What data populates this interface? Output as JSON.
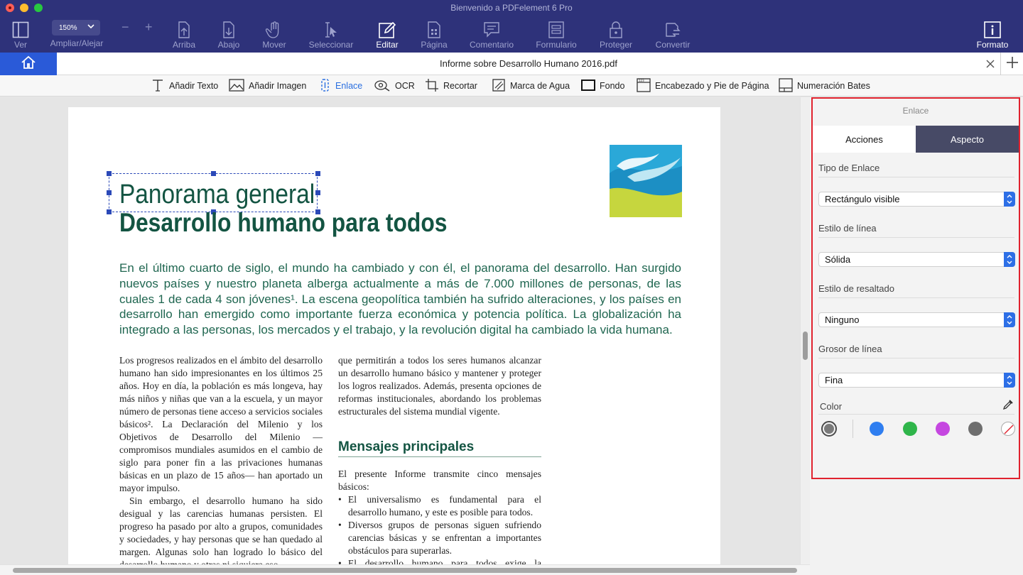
{
  "window": {
    "title": "Bienvenido a PDFelement 6 Pro"
  },
  "toolbar": {
    "ver": "Ver",
    "zoom_value": "150%",
    "zoom_label": "Ampliar/Alejar",
    "zoom_out": "−",
    "zoom_in": "+",
    "arriba": "Arriba",
    "abajo": "Abajo",
    "mover": "Mover",
    "seleccionar": "Seleccionar",
    "editar": "Editar",
    "pagina": "Página",
    "comentario": "Comentario",
    "formulario": "Formulario",
    "proteger": "Proteger",
    "convertir": "Convertir",
    "formato": "Formato"
  },
  "tab": {
    "title": "Informe sobre Desarrollo Humano 2016.pdf"
  },
  "edit_tools": {
    "add_text": "Añadir Texto",
    "add_image": "Añadir Imagen",
    "link": "Enlace",
    "ocr": "OCR",
    "crop": "Recortar",
    "watermark": "Marca de Agua",
    "background": "Fondo",
    "header_footer": "Encabezado y Pie de Página",
    "bates": "Numeración Bates"
  },
  "document": {
    "title": "Panorama general",
    "heading": "Desarrollo humano para todos",
    "intro": "En el último cuarto de siglo, el mundo ha cambiado y con él, el panorama del desarrollo. Han surgido nuevos países y nuestro planeta alberga actualmente a más de 7.000 millones de personas, de las cuales 1 de cada 4 son jóvenes¹. La escena geopolítica también ha sufrido alteraciones, y los países en desarrollo han emergido como importante fuerza económica y potencia política. La globalización ha integrado a las personas, los mercados y el trabajo, y la revolución digital ha cambiado la vida humana.",
    "col1_p1": "Los progresos realizados en el ámbito del desarrollo humano han sido impresionantes en los últimos 25 años. Hoy en día, la población es más longeva, hay más niños y niñas que van a la escuela, y un mayor número de personas tiene acceso a servicios sociales básicos². La Declaración del Milenio y los Objetivos de Desarrollo del Milenio —compromisos mundiales asumidos en el cambio de siglo para poner fin a las privaciones humanas básicas en un plazo de 15 años— han aportado un mayor impulso.",
    "col1_p2": "Sin embargo, el desarrollo humano ha sido desigual y las carencias humanas persisten. El progreso ha pasado por alto a grupos, comunidades y sociedades, y hay personas que se han quedado al margen. Algunas solo han logrado lo básico del desarrollo humano y otras ni siquiera eso.",
    "col2_p1": "que permitirán a todos los seres humanos alcanzar un desarrollo humano básico y mantener y proteger los logros realizados. Además, presenta opciones de reformas institucionales, abordando los problemas estructurales del sistema mundial vigente.",
    "messages_heading": "Mensajes principales",
    "messages_intro": "El presente Informe transmite cinco mensajes básicos:",
    "bullets": [
      "El universalismo es fundamental para el desarrollo humano, y este es posible para todos.",
      "Diversos grupos de personas siguen sufriendo carencias básicas y se enfrentan a importantes obstáculos para superarlas.",
      "El desarrollo humano para todos exige la reorientación de algunos aspectos analíticos y"
    ]
  },
  "panel": {
    "title": "Enlace",
    "tab_actions": "Acciones",
    "tab_appearance": "Aspecto",
    "link_type_label": "Tipo de Enlace",
    "link_type_value": "Rectángulo visible",
    "line_style_label": "Estilo de línea",
    "line_style_value": "Sólida",
    "highlight_label": "Estilo de resaltado",
    "highlight_value": "Ninguno",
    "thickness_label": "Grosor de línea",
    "thickness_value": "Fina",
    "color_label": "Color",
    "colors": [
      "#7a7a7a",
      "#2f7ef0",
      "#2fb54a",
      "#c547e0",
      "#6e6e6e"
    ]
  }
}
